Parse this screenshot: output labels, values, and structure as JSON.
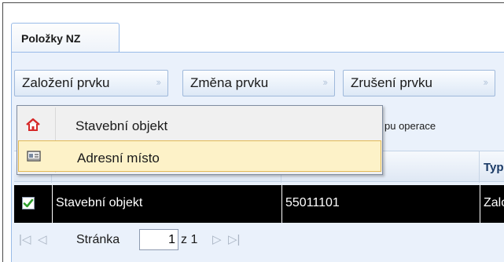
{
  "tabs": [
    {
      "label": "Položky NZ"
    }
  ],
  "toolbar": {
    "create_label": "Založení prvku",
    "change_label": "Změna prvku",
    "cancel_label": "Zrušení prvku",
    "chevron": "»"
  },
  "hint_text": "pu operace",
  "menu": {
    "items": [
      {
        "label": "Stavební objekt",
        "icon": "house-icon"
      },
      {
        "label": "Adresní místo",
        "icon": "address-card-icon"
      }
    ]
  },
  "grid": {
    "columns": [
      {
        "label": "Typ"
      }
    ],
    "rows": [
      {
        "checked": true,
        "object": "Stavební objekt",
        "code": "55011101",
        "type": "Zalo"
      }
    ]
  },
  "pager": {
    "page_label": "Stránka",
    "page_value": "1",
    "of_text": "z 1"
  },
  "colors": {
    "panel_bg": "#eaf1fb",
    "border_blue": "#99bbe8",
    "selected_row": "#000000",
    "menu_highlight": "#fdf2c8",
    "checkbox_green": "#2e9e2e",
    "house_red": "#d62828"
  }
}
